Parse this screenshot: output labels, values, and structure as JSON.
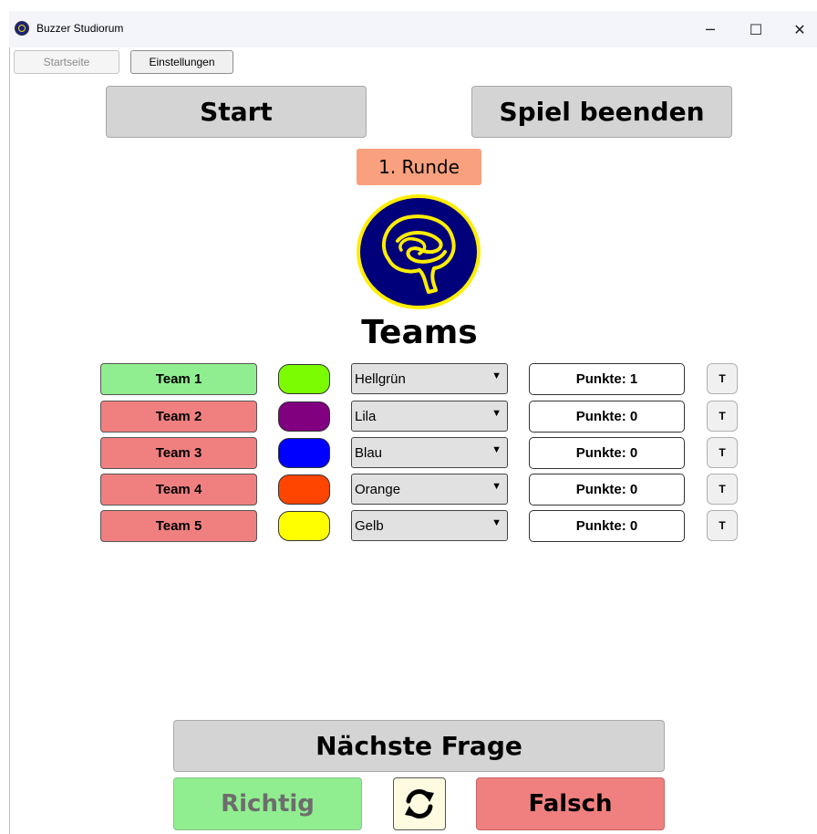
{
  "window": {
    "title": "Buzzer Studiorum",
    "icon": "brain-logo-icon",
    "controls": {
      "minimize": "─",
      "maximize": "☐",
      "close": "✕"
    }
  },
  "nav": {
    "home_label": "Startseite",
    "home_disabled": true,
    "settings_label": "Einstellungen"
  },
  "actions": {
    "start_label": "Start",
    "end_label": "Spiel beenden"
  },
  "round": {
    "label": "1. Runde"
  },
  "teams_heading": "Teams",
  "teams": [
    {
      "name": "Team 1",
      "button_color": "#90ee90",
      "swatch_color": "#7cfc00",
      "color_name": "Hellgrün",
      "score_label": "Punkte: 1",
      "t_label": "T"
    },
    {
      "name": "Team 2",
      "button_color": "#f08080",
      "swatch_color": "#800080",
      "color_name": "Lila",
      "score_label": "Punkte: 0",
      "t_label": "T"
    },
    {
      "name": "Team 3",
      "button_color": "#f08080",
      "swatch_color": "#0000ff",
      "color_name": "Blau",
      "score_label": "Punkte: 0",
      "t_label": "T"
    },
    {
      "name": "Team 4",
      "button_color": "#f08080",
      "swatch_color": "#ff4500",
      "color_name": "Orange",
      "score_label": "Punkte: 0",
      "t_label": "T"
    },
    {
      "name": "Team 5",
      "button_color": "#f08080",
      "swatch_color": "#ffff00",
      "color_name": "Gelb",
      "score_label": "Punkte: 0",
      "t_label": "T"
    }
  ],
  "footer": {
    "next_label": "Nächste Frage",
    "correct_label": "Richtig",
    "wrong_label": "Falsch",
    "reload_icon": "refresh-icon"
  },
  "colors": {
    "correct": "#90ee90",
    "wrong": "#f08080",
    "round_badge": "#f9a07e",
    "logo_background": "#00007a",
    "logo_accent": "#ffee00"
  }
}
